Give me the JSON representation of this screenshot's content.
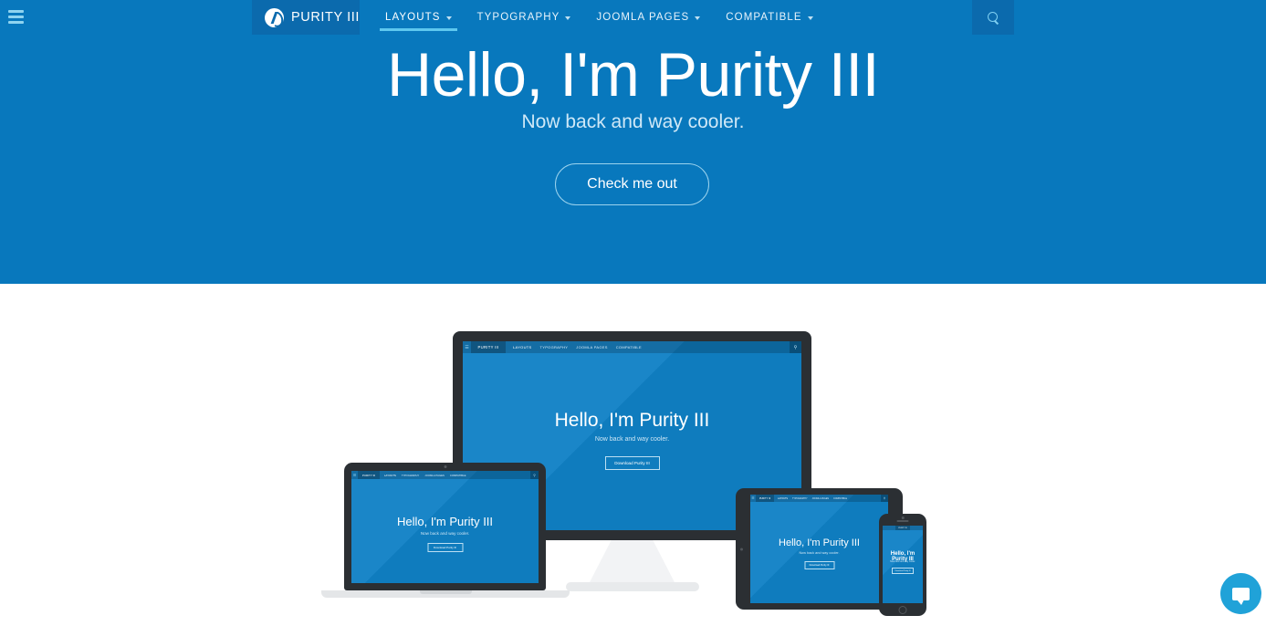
{
  "site": {
    "brand": "PURITY III",
    "accent_blue": "#0878bd",
    "nav_dark_blue": "#0b6aad",
    "underline_blue": "#5ec8ef",
    "chat_blue": "#20a2d8"
  },
  "nav": {
    "menu_toggle_icon": "hamburger-icon",
    "logo_icon": "purity-logo-icon",
    "search_icon": "search-icon",
    "items": [
      {
        "label": "LAYOUTS",
        "has_caret": true,
        "active": true
      },
      {
        "label": "TYPOGRAPHY",
        "has_caret": true,
        "active": false
      },
      {
        "label": "JOOMLA PAGES",
        "has_caret": true,
        "active": false
      },
      {
        "label": "COMPATIBLE",
        "has_caret": true,
        "active": false
      }
    ]
  },
  "hero": {
    "title": "Hello, I'm Purity III",
    "subtitle": "Now back and way cooler.",
    "cta_label": "Check me out"
  },
  "mockup": {
    "title": "Hello, I'm Purity III",
    "subtitle": "Now back and way cooler.",
    "button_label": "Download Purity III",
    "brand": "PURITY III",
    "nav_items": [
      "LAYOUTS",
      "TYPOGRAPHY",
      "JOOMLA PAGES",
      "COMPATIBLE"
    ],
    "phone_title": "Hello, I'm Purity III",
    "phone_subtitle": "Now back and way cooler.",
    "phone_button_label": "Download Purity III",
    "devices": [
      "monitor",
      "laptop",
      "tablet",
      "phone"
    ]
  },
  "chat": {
    "icon": "chat-bubble-icon"
  }
}
